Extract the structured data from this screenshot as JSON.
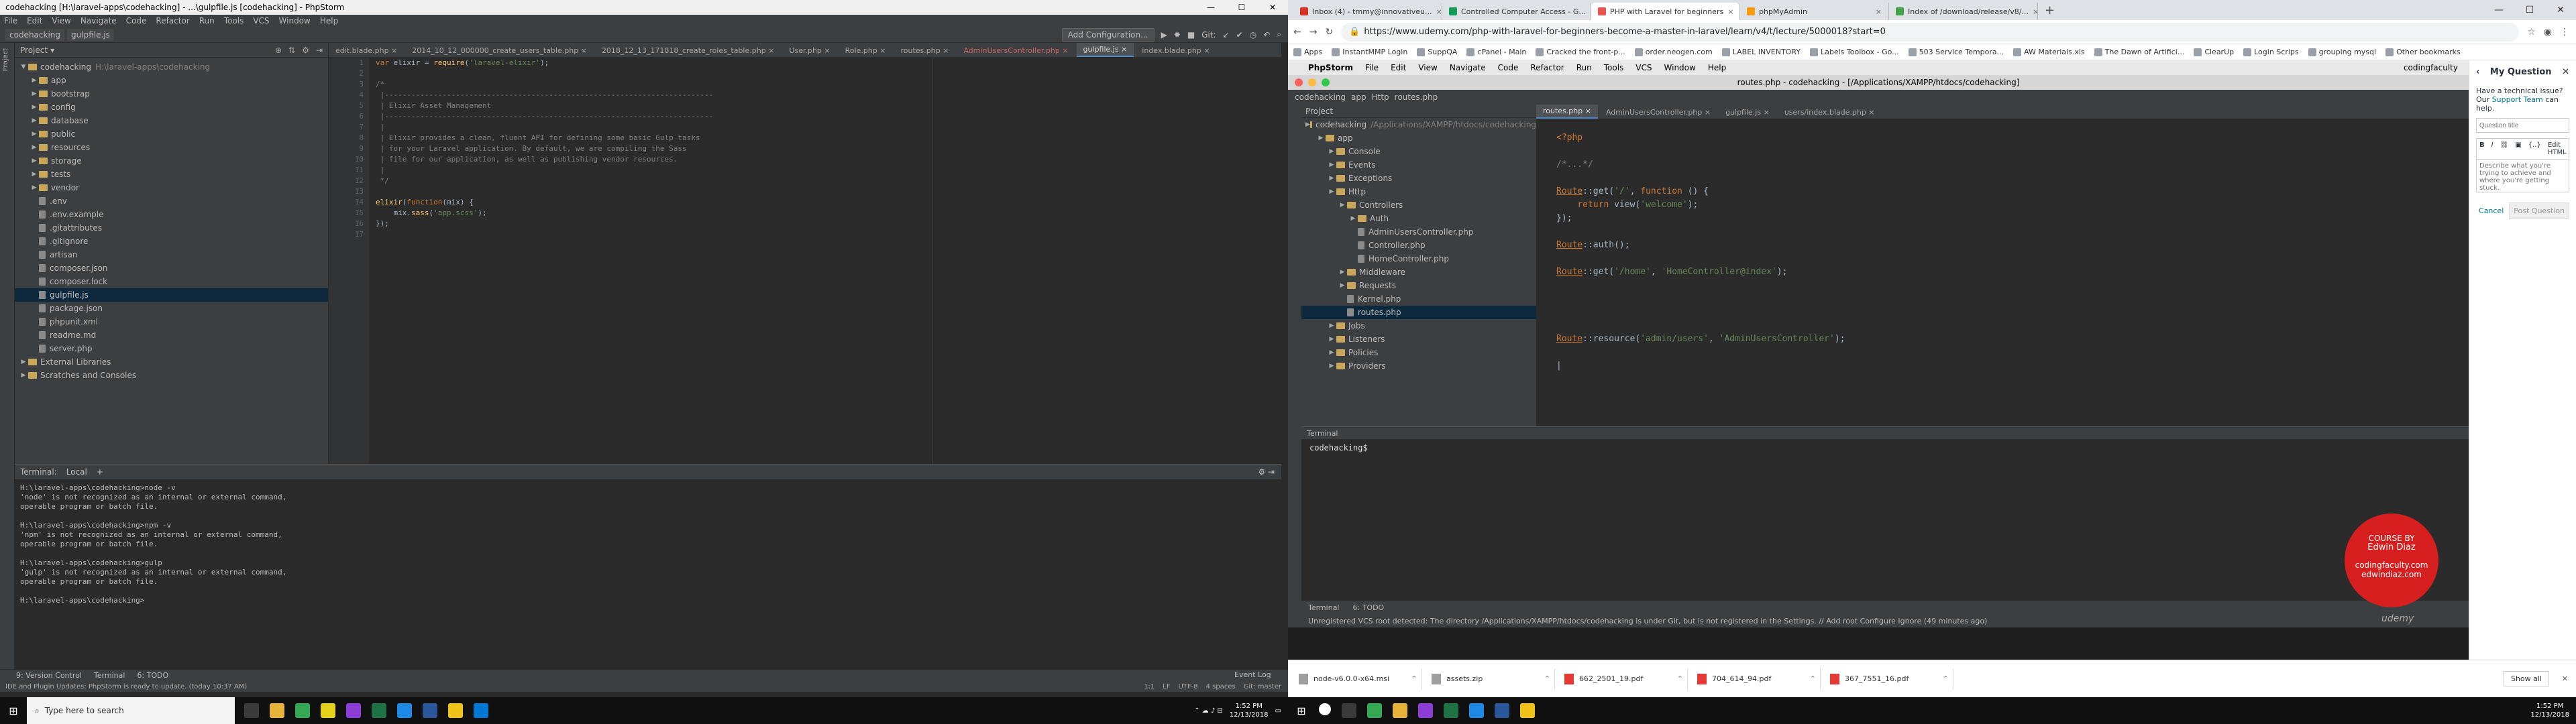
{
  "left": {
    "title": "codehacking [H:\\laravel-apps\\codehacking] - ...\\gulpfile.js [codehacking] - PhpStorm",
    "menu": [
      "File",
      "Edit",
      "View",
      "Navigate",
      "Code",
      "Refactor",
      "Run",
      "Tools",
      "VCS",
      "Window",
      "Help"
    ],
    "crumbs": [
      "codehacking",
      "gulpfile.js"
    ],
    "add_config": "Add Configuration...",
    "git_label": "Git:",
    "project_label": "Project",
    "tree": [
      {
        "label": "codehacking",
        "extra": "H:\\laravel-apps\\codehacking",
        "type": "folder",
        "depth": 0,
        "open": true
      },
      {
        "label": "app",
        "type": "folder",
        "depth": 1
      },
      {
        "label": "bootstrap",
        "type": "folder",
        "depth": 1
      },
      {
        "label": "config",
        "type": "folder",
        "depth": 1
      },
      {
        "label": "database",
        "type": "folder",
        "depth": 1
      },
      {
        "label": "public",
        "type": "folder",
        "depth": 1
      },
      {
        "label": "resources",
        "type": "folder",
        "depth": 1
      },
      {
        "label": "storage",
        "type": "folder",
        "depth": 1
      },
      {
        "label": "tests",
        "type": "folder",
        "depth": 1
      },
      {
        "label": "vendor",
        "type": "folder",
        "depth": 1
      },
      {
        "label": ".env",
        "type": "file",
        "depth": 1
      },
      {
        "label": ".env.example",
        "type": "file",
        "depth": 1
      },
      {
        "label": ".gitattributes",
        "type": "file",
        "depth": 1
      },
      {
        "label": ".gitignore",
        "type": "file",
        "depth": 1
      },
      {
        "label": "artisan",
        "type": "file",
        "depth": 1
      },
      {
        "label": "composer.json",
        "type": "file",
        "depth": 1
      },
      {
        "label": "composer.lock",
        "type": "file",
        "depth": 1
      },
      {
        "label": "gulpfile.js",
        "type": "file",
        "depth": 1,
        "selected": true
      },
      {
        "label": "package.json",
        "type": "file",
        "depth": 1
      },
      {
        "label": "phpunit.xml",
        "type": "file",
        "depth": 1
      },
      {
        "label": "readme.md",
        "type": "file",
        "depth": 1
      },
      {
        "label": "server.php",
        "type": "file",
        "depth": 1
      },
      {
        "label": "External Libraries",
        "type": "folder",
        "depth": 0
      },
      {
        "label": "Scratches and Consoles",
        "type": "folder",
        "depth": 0
      }
    ],
    "tabs": [
      {
        "label": "edit.blade.php",
        "active": false
      },
      {
        "label": "2014_10_12_000000_create_users_table.php",
        "active": false
      },
      {
        "label": "2018_12_13_171818_create_roles_table.php",
        "active": false
      },
      {
        "label": "User.php",
        "active": false
      },
      {
        "label": "Role.php",
        "active": false
      },
      {
        "label": "routes.php",
        "active": false
      },
      {
        "label": "AdminUsersController.php",
        "active": false,
        "red": true
      },
      {
        "label": "gulpfile.js",
        "active": true
      },
      {
        "label": "index.blade.php",
        "active": false
      }
    ],
    "code": [
      "var elixir = require('laravel-elixir');",
      "",
      "/*",
      " |--------------------------------------------------------------------------",
      " | Elixir Asset Management",
      " |--------------------------------------------------------------------------",
      " |",
      " | Elixir provides a clean, fluent API for defining some basic Gulp tasks",
      " | for your Laravel application. By default, we are compiling the Sass",
      " | file for our application, as well as publishing vendor resources.",
      " |",
      " */",
      "",
      "elixir(function(mix) {",
      "    mix.sass('app.scss');",
      "});",
      ""
    ],
    "terminal_tabs": [
      "Terminal:",
      "Local"
    ],
    "terminal_lines": [
      "H:\\laravel-apps\\codehacking>node -v",
      "'node' is not recognized as an internal or external command,",
      "operable program or batch file.",
      "",
      "H:\\laravel-apps\\codehacking>npm -v",
      "'npm' is not recognized as an internal or external command,",
      "operable program or batch file.",
      "",
      "H:\\laravel-apps\\codehacking>gulp",
      "'gulp' is not recognized as an internal or external command,",
      "operable program or batch file.",
      "",
      "H:\\laravel-apps\\codehacking>"
    ],
    "bottom_tools": [
      "9: Version Control",
      "Terminal",
      "6: TODO"
    ],
    "event_log": "Event Log",
    "status_msg": "IDE and Plugin Updates: PhpStorm is ready to update. (today 10:37 AM)",
    "status_right": [
      "1:1",
      "LF",
      "UTF-8",
      "4 spaces",
      "Git: master"
    ],
    "search_placeholder": "Type here to search",
    "clock_time": "1:52 PM",
    "clock_date": "12/13/2018"
  },
  "right": {
    "tabs": [
      {
        "label": "Inbox (4) - tmmy@innovativeu...",
        "color": "#d93025",
        "active": false
      },
      {
        "label": "Controlled Computer Access - G...",
        "color": "#0f9d58",
        "active": false
      },
      {
        "label": "PHP with Laravel for beginners",
        "color": "#ec5252",
        "active": true
      },
      {
        "label": "phpMyAdmin",
        "color": "#f89c0e",
        "active": false
      },
      {
        "label": "Index of /download/release/v8/...",
        "color": "#43a047",
        "active": false
      }
    ],
    "url": "https://www.udemy.com/php-with-laravel-for-beginners-become-a-master-in-laravel/learn/v4/t/lecture/5000018?start=0",
    "bookmarks": [
      "Apps",
      "InstantMMP Login",
      "SuppQA",
      "cPanel - Main",
      "Cracked the front-p...",
      "order.neogen.com",
      "LABEL INVENTORY",
      "Labels Toolbox - Go...",
      "503 Service Tempora...",
      "AW Materials.xls",
      "The Dawn of Artifici...",
      "ClearUp",
      "Login Scrips",
      "grouping mysql",
      "Other bookmarks"
    ],
    "mac_menu": [
      "PhpStorm",
      "File",
      "Edit",
      "View",
      "Navigate",
      "Code",
      "Refactor",
      "Run",
      "Tools",
      "VCS",
      "Window",
      "Help"
    ],
    "mac_user": "codingfaculty",
    "mac_title": "routes.php - codehacking - [/Applications/XAMPP/htdocs/codehacking]",
    "mac_crumbs": [
      "codehacking",
      "app",
      "Http",
      "routes.php"
    ],
    "v_project": "Project",
    "v_tree": [
      {
        "label": "codehacking",
        "extra": "/Applications/XAMPP/htdocs/codehacking",
        "depth": 0,
        "type": "folder"
      },
      {
        "label": "app",
        "depth": 1,
        "type": "folder"
      },
      {
        "label": "Console",
        "depth": 2,
        "type": "folder"
      },
      {
        "label": "Events",
        "depth": 2,
        "type": "folder"
      },
      {
        "label": "Exceptions",
        "depth": 2,
        "type": "folder"
      },
      {
        "label": "Http",
        "depth": 2,
        "type": "folder"
      },
      {
        "label": "Controllers",
        "depth": 3,
        "type": "folder"
      },
      {
        "label": "Auth",
        "depth": 4,
        "type": "folder"
      },
      {
        "label": "AdminUsersController.php",
        "depth": 4,
        "type": "file"
      },
      {
        "label": "Controller.php",
        "depth": 4,
        "type": "file"
      },
      {
        "label": "HomeController.php",
        "depth": 4,
        "type": "file"
      },
      {
        "label": "Middleware",
        "depth": 3,
        "type": "folder"
      },
      {
        "label": "Requests",
        "depth": 3,
        "type": "folder"
      },
      {
        "label": "Kernel.php",
        "depth": 3,
        "type": "file"
      },
      {
        "label": "routes.php",
        "depth": 3,
        "type": "file",
        "selected": true
      },
      {
        "label": "Jobs",
        "depth": 2,
        "type": "folder"
      },
      {
        "label": "Listeners",
        "depth": 2,
        "type": "folder"
      },
      {
        "label": "Policies",
        "depth": 2,
        "type": "folder"
      },
      {
        "label": "Providers",
        "depth": 2,
        "type": "folder"
      }
    ],
    "v_tabs": [
      {
        "label": "routes.php",
        "active": true
      },
      {
        "label": "AdminUsersController.php",
        "active": false
      },
      {
        "label": "gulpfile.js",
        "active": false
      },
      {
        "label": "users/index.blade.php",
        "active": false
      }
    ],
    "v_code": [
      "<?php",
      "",
      "/*...*/",
      "",
      "Route::get('/', function () {",
      "    return view('welcome');",
      "});",
      "",
      "Route::auth();",
      "",
      "Route::get('/home', 'HomeController@index');",
      "",
      "",
      "",
      "",
      "Route::resource('admin/users', 'AdminUsersController');",
      "",
      "|"
    ],
    "v_terminal": "Terminal",
    "v_prompt": "codehacking$",
    "v_toolbar": [
      "Terminal",
      "6: TODO"
    ],
    "v_status": "Unregistered VCS root detected: The directory /Applications/XAMPP/htdocs/codehacking is under Git, but is not registered in the Settings. // Add root  Configure  Ignore (49 minutes ago)",
    "course_by": "COURSE BY",
    "course_name": "Edwin Diaz",
    "course_site1": "codingfaculty.com",
    "course_site2": "edwindiaz.com",
    "udemy": "udemy",
    "qa_title": "My Question",
    "qa_help_a": "Have a technical issue? Our ",
    "qa_help_link": "Support Team",
    "qa_help_b": " can help.",
    "qa_title_placeholder": "Question title",
    "qa_edit_html": "Edit HTML",
    "qa_body_placeholder": "Describe what you're trying to achieve and where you're getting stuck.",
    "qa_cancel": "Cancel",
    "qa_post": "Post Question",
    "downloads": [
      {
        "label": "node-v6.0.0-x64.msi",
        "kind": "msi"
      },
      {
        "label": "assets.zip",
        "kind": "zip"
      },
      {
        "label": "662_2501_19.pdf",
        "kind": "pdf"
      },
      {
        "label": "704_614_94.pdf",
        "kind": "pdf"
      },
      {
        "label": "367_7551_16.pdf",
        "kind": "pdf"
      }
    ],
    "show_all": "Show all",
    "clock_time": "1:52 PM",
    "clock_date": "12/13/2018"
  }
}
